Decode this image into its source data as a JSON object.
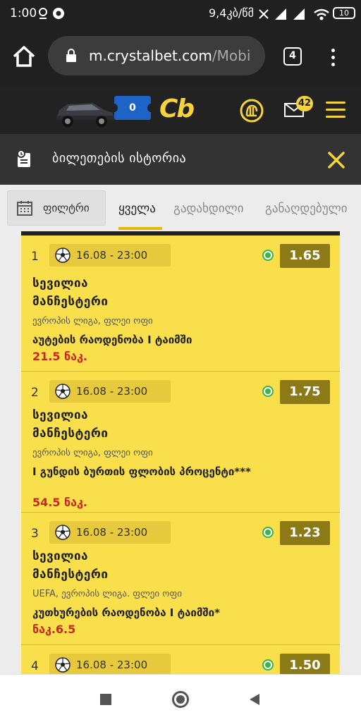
{
  "status_bar": {
    "time": "1:00",
    "network": "9,4კბ/წმ",
    "battery": "10"
  },
  "browser": {
    "url_main": "m.crystalbet.com",
    "url_path": "/Mobi",
    "tab_count": "4"
  },
  "site_header": {
    "ticket_count": "0",
    "logo": "Cb",
    "mail_badge": "42"
  },
  "page": {
    "title": "ბილეთების ისტორია"
  },
  "tabs": {
    "filter_label": "ფილტრი",
    "items": [
      "ყველა",
      "გადახდილი",
      "განაღდებული"
    ],
    "active": "ყველა"
  },
  "bets": [
    {
      "index": "1",
      "date": "16.08 - 23:00",
      "odds": "1.65",
      "home": "სევილია",
      "away": "მანჩესტერი",
      "league": "ევროპის ლიგა, ფლეი ოფი",
      "market": "აუტების რაოდენობა I ტაიმში",
      "pick": "21.5 ნაკ."
    },
    {
      "index": "2",
      "date": "16.08 - 23:00",
      "odds": "1.75",
      "home": "სევილია",
      "away": "მანჩესტერი",
      "league": "ევროპის ლიგა, ფლეი ოფი",
      "market": "I გუნდის ბურთის ფლობის პროცენტი***",
      "pick": "54.5 ნაკ."
    },
    {
      "index": "3",
      "date": "16.08 - 23:00",
      "odds": "1.23",
      "home": "სევილია",
      "away": "მანჩესტერი",
      "league": "UEFA, ევროპის ლიგა. ფლეი ოფი",
      "market": "კუთხურების რაოდენობა I ტაიმში*",
      "pick": "ნაკ.6.5"
    },
    {
      "index": "4",
      "date": "16.08 - 23:00",
      "odds": "1.50"
    }
  ]
}
